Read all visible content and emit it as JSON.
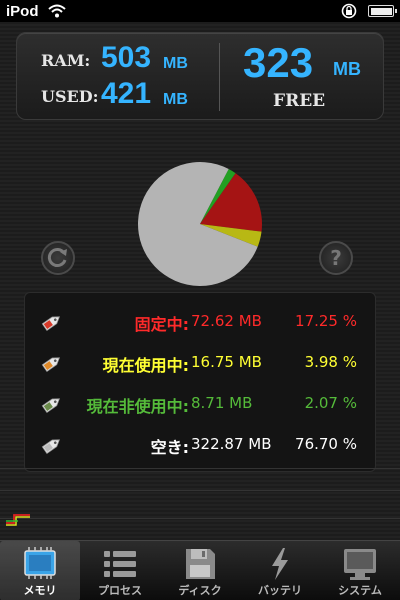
{
  "status_bar": {
    "carrier": "iPod"
  },
  "summary": {
    "ram_label": "RAM:",
    "ram_value": "503",
    "ram_unit": "MB",
    "used_label": "USED:",
    "used_value": "421",
    "used_unit": "MB",
    "free_value": "323",
    "free_unit": "MB",
    "free_label": "FREE"
  },
  "chart_data": {
    "type": "pie",
    "series": [
      {
        "name": "固定中",
        "value": 17.25,
        "color": "#a51414"
      },
      {
        "name": "現在使用中",
        "value": 3.98,
        "color": "#b8b814"
      },
      {
        "name": "現在非使用中",
        "value": 2.07,
        "color": "#22a022"
      },
      {
        "name": "空き",
        "value": 76.7,
        "color": "#b4b4b4"
      }
    ]
  },
  "buttons": {
    "refresh_icon": "refresh-icon",
    "help_glyph": "?"
  },
  "legend": [
    {
      "label": "固定中:",
      "mb": "72.62 MB",
      "pct": "17.25 %",
      "color": "#ff2a2a",
      "label_color": "#ff2a2a",
      "tag_color": "#d83a2a"
    },
    {
      "label": "現在使用中:",
      "mb": "16.75 MB",
      "pct": "3.98 %",
      "color": "#ffff33",
      "label_color": "#ffff33",
      "tag_color": "#e08a2a"
    },
    {
      "label": "現在非使用中:",
      "mb": "8.71 MB",
      "pct": "2.07 %",
      "color": "#55bb3a",
      "label_color": "#55bb3a",
      "tag_color": "#6a8a4a"
    },
    {
      "label": "空き:",
      "mb": "322.87 MB",
      "pct": "76.70 %",
      "color": "#ffffff",
      "label_color": "#ffffff",
      "tag_color": "#bbbbbb"
    }
  ],
  "tabs": [
    {
      "label": "メモリ",
      "icon": "memory-chip-icon",
      "active": true
    },
    {
      "label": "プロセス",
      "icon": "process-list-icon",
      "active": false
    },
    {
      "label": "ディスク",
      "icon": "disk-icon",
      "active": false
    },
    {
      "label": "バッテリ",
      "icon": "battery-bolt-icon",
      "active": false
    },
    {
      "label": "システム",
      "icon": "monitor-icon",
      "active": false
    }
  ]
}
